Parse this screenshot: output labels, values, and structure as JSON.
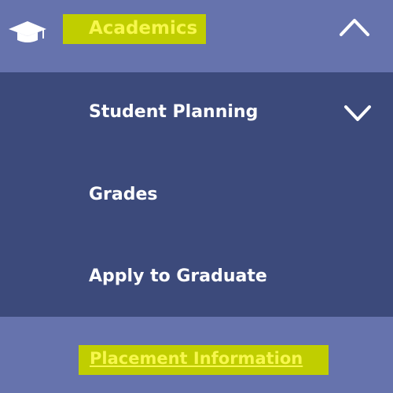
{
  "colors": {
    "header_bg": "#6673ad",
    "submenu_bg": "#3c4a7b",
    "highlight_bg": "#c0ce00",
    "highlight_text": "#f7f74c",
    "item_text": "#ffffff"
  },
  "menu": {
    "header": {
      "icon": "graduation-cap-icon",
      "label": "Academics",
      "expanded_icon": "chevron-up-icon"
    },
    "items": [
      {
        "label": "Student Planning",
        "icon": "chevron-down-icon"
      },
      {
        "label": "Grades"
      },
      {
        "label": "Apply to Graduate"
      }
    ],
    "footer_item": {
      "label": "Placement Information"
    }
  }
}
